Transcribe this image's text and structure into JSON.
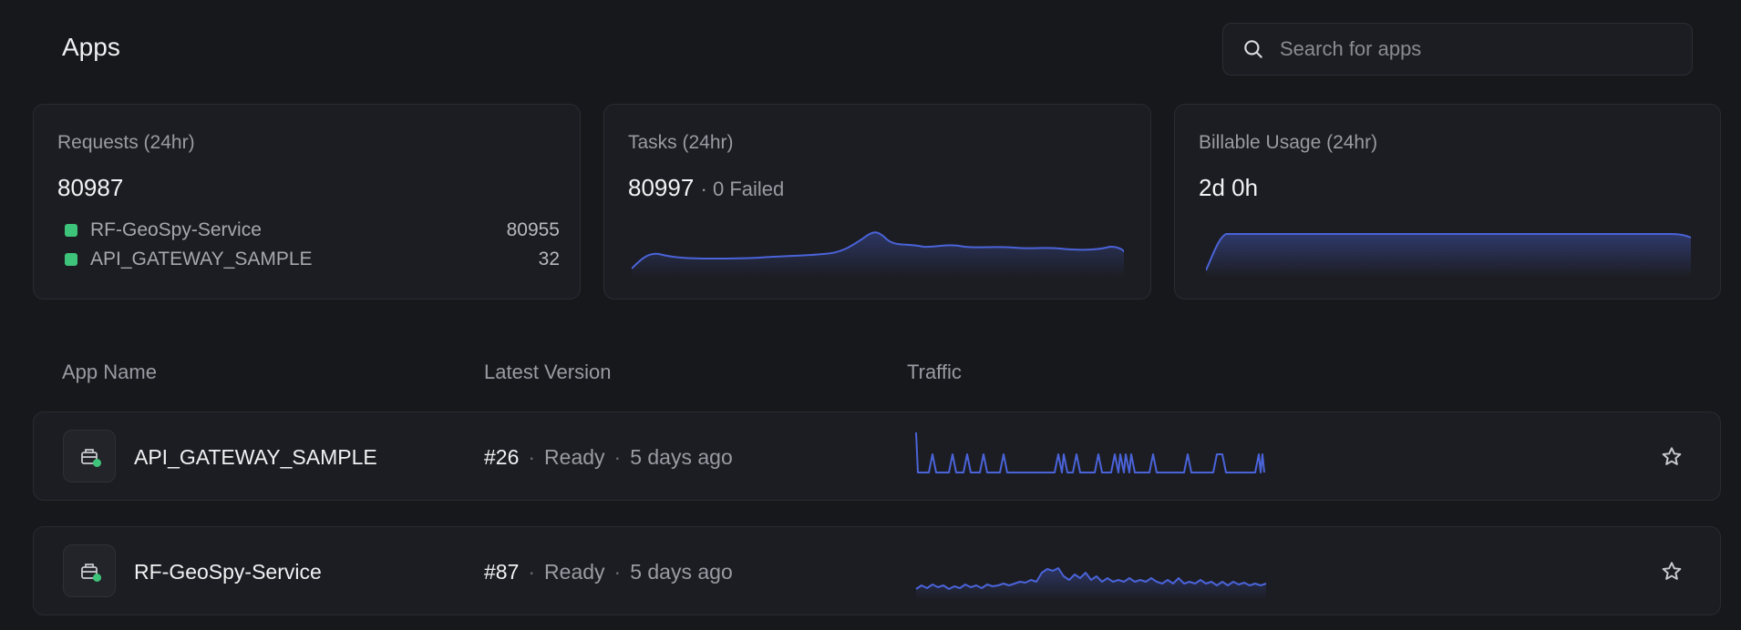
{
  "page": {
    "title": "Apps"
  },
  "search": {
    "placeholder": "Search for apps",
    "icon": "search-icon"
  },
  "cards": {
    "requests": {
      "title": "Requests (24hr)",
      "value": "80987",
      "items": [
        {
          "name": "RF-GeoSpy-Service",
          "count": "80955",
          "color": "#3ec47a"
        },
        {
          "name": "API_GATEWAY_SAMPLE",
          "count": "32",
          "color": "#3ec47a"
        }
      ]
    },
    "tasks": {
      "title": "Tasks (24hr)",
      "value": "80997",
      "sub": "· 0 Failed"
    },
    "billable": {
      "title": "Billable Usage (24hr)",
      "value": "2d 0h"
    }
  },
  "table": {
    "headers": {
      "app_name": "App Name",
      "latest_version": "Latest Version",
      "traffic": "Traffic"
    },
    "rows": [
      {
        "name": "API_GATEWAY_SAMPLE",
        "version": "#26",
        "status": "Ready",
        "age": "5 days ago",
        "status_color": "#3ec47a"
      },
      {
        "name": "RF-GeoSpy-Service",
        "version": "#87",
        "status": "Ready",
        "age": "5 days ago",
        "status_color": "#3ec47a"
      }
    ]
  },
  "colors": {
    "accent": "#4a63d9",
    "background": "#17181c",
    "card": "#1c1d22",
    "status_ok": "#3ec47a"
  }
}
